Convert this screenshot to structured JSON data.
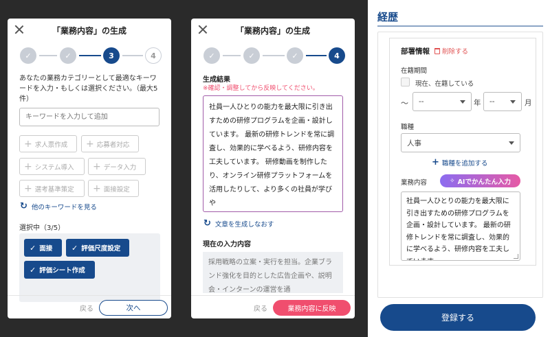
{
  "modal1": {
    "title": "「業務内容」の生成",
    "steps": [
      "✓",
      "✓",
      "3",
      "4"
    ],
    "instruction": "あなたの業務カテゴリーとして最適なキーワードを入力・もしくは選択ください。（最大5件）",
    "keyword_placeholder": "キーワードを入力して追加",
    "suggested_keywords": [
      "求人票作成",
      "応募者対応",
      "システム導入",
      "データ入力",
      "選考基準策定",
      "面接設定"
    ],
    "more_keywords": "他のキーワードを見る",
    "selected_label": "選択中（3/5）",
    "selected_keywords": [
      "面接",
      "評価尺度設定",
      "評価シート作成"
    ],
    "back": "戻る",
    "next": "次へ"
  },
  "modal2": {
    "title": "「業務内容」の生成",
    "steps": [
      "✓",
      "✓",
      "✓",
      "4"
    ],
    "result_title": "生成結果",
    "result_note": "※確認・調整してから反映してください。",
    "generated_text": "社員一人ひとりの能力を最大限に引き出すための研修プログラムを企画・設計しています。 最新の研修トレンドを常に調査し、効果的に学べるよう、研修内容を工夫しています。 研修動画を制作したり、オンライン研修プラットフォームを活用したりして、より多くの社員が学びや",
    "regenerate": "文章を生成しなおす",
    "current_title": "現在の入力内容",
    "current_text": "採用戦略の立案・実行を担当。企業ブランド強化を目的とした広告企画や、説明会・インターンの運営を通",
    "back": "戻る",
    "apply": "業務内容に反映"
  },
  "resume": {
    "section_title": "経歴",
    "dept_title": "部署情報",
    "delete": "削除する",
    "period_label": "在籍期間",
    "currently_employed": "現在、在籍している",
    "tilde": "〜",
    "year_value": "--",
    "year_unit": "年",
    "month_value": "--",
    "month_unit": "月",
    "job_type_label": "職種",
    "job_type_value": "人事",
    "add_job_type": "職種を追加する",
    "duty_label": "業務内容",
    "ai_button": "AIでかんたん入力",
    "duty_text": "社員一人ひとりの能力を最大限に引き出すための研修プログラムを企画・設計しています。 最新の研修トレンドを常に調査し、効果的に学べるよう、研修内容を工夫しています",
    "register": "登録する"
  }
}
